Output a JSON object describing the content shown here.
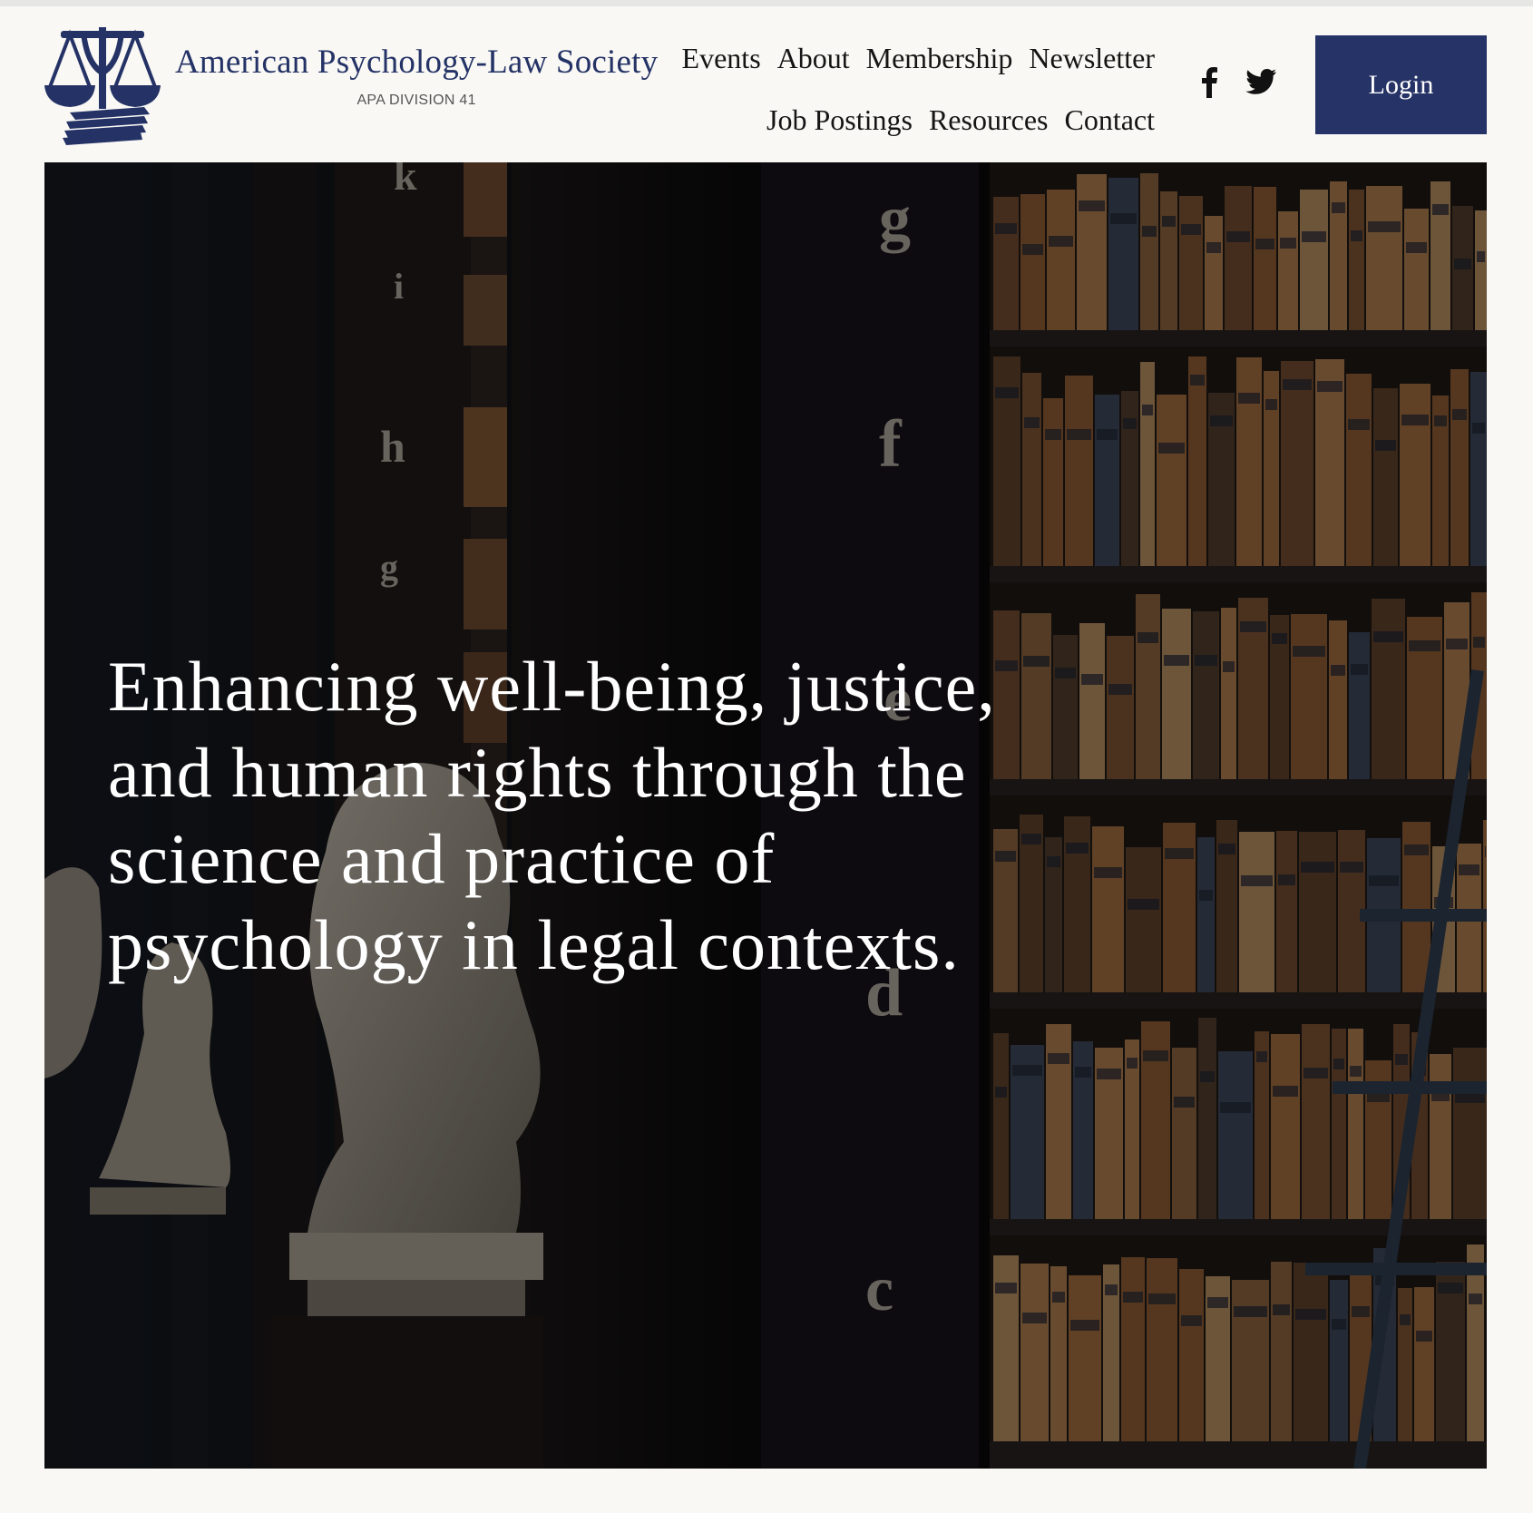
{
  "brand": {
    "name": "American Psychology-Law Society",
    "subtitle": "APA DIVISION 41",
    "color": "#243266"
  },
  "nav": {
    "row1": [
      "Events",
      "About",
      "Membership",
      "Newsletter"
    ],
    "row2": [
      "Job Postings",
      "Resources",
      "Contact"
    ]
  },
  "social": {
    "facebook_icon": "facebook-icon",
    "twitter_icon": "twitter-icon"
  },
  "login": {
    "label": "Login",
    "color": "#263366"
  },
  "hero": {
    "text": "Enhancing well-being, justice, and human rights through the science and practice of psychology in legal contexts.",
    "shelf_letters": [
      "k",
      "i",
      "h",
      "g",
      "g",
      "f",
      "e",
      "d",
      "c"
    ]
  }
}
